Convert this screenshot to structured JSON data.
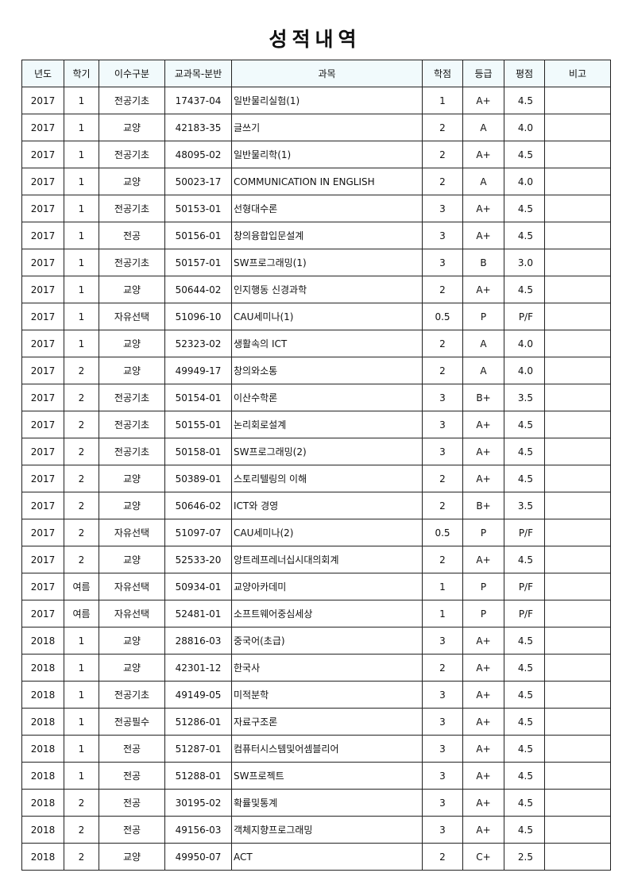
{
  "title": "성적내역",
  "columns": {
    "year": "년도",
    "term": "학기",
    "category": "이수구분",
    "code": "교과목-분반",
    "course": "과목",
    "credits": "학점",
    "grade": "등급",
    "score": "평점",
    "note": "비고"
  },
  "rows": [
    {
      "year": "2017",
      "term": "1",
      "category": "전공기초",
      "code": "17437-04",
      "course": "일반물리실험(1)",
      "credits": "1",
      "grade": "A+",
      "score": "4.5",
      "note": ""
    },
    {
      "year": "2017",
      "term": "1",
      "category": "교양",
      "code": "42183-35",
      "course": "글쓰기",
      "credits": "2",
      "grade": "A",
      "score": "4.0",
      "note": ""
    },
    {
      "year": "2017",
      "term": "1",
      "category": "전공기초",
      "code": "48095-02",
      "course": "일반물리학(1)",
      "credits": "2",
      "grade": "A+",
      "score": "4.5",
      "note": ""
    },
    {
      "year": "2017",
      "term": "1",
      "category": "교양",
      "code": "50023-17",
      "course": "COMMUNICATION IN ENGLISH",
      "credits": "2",
      "grade": "A",
      "score": "4.0",
      "note": ""
    },
    {
      "year": "2017",
      "term": "1",
      "category": "전공기초",
      "code": "50153-01",
      "course": "선형대수론",
      "credits": "3",
      "grade": "A+",
      "score": "4.5",
      "note": ""
    },
    {
      "year": "2017",
      "term": "1",
      "category": "전공",
      "code": "50156-01",
      "course": "창의융합입문설계",
      "credits": "3",
      "grade": "A+",
      "score": "4.5",
      "note": ""
    },
    {
      "year": "2017",
      "term": "1",
      "category": "전공기초",
      "code": "50157-01",
      "course": "SW프로그래밍(1)",
      "credits": "3",
      "grade": "B",
      "score": "3.0",
      "note": ""
    },
    {
      "year": "2017",
      "term": "1",
      "category": "교양",
      "code": "50644-02",
      "course": "인지행동 신경과학",
      "credits": "2",
      "grade": "A+",
      "score": "4.5",
      "note": ""
    },
    {
      "year": "2017",
      "term": "1",
      "category": "자유선택",
      "code": "51096-10",
      "course": "CAU세미나(1)",
      "credits": "0.5",
      "grade": "P",
      "score": "P/F",
      "note": ""
    },
    {
      "year": "2017",
      "term": "1",
      "category": "교양",
      "code": "52323-02",
      "course": "생활속의 ICT",
      "credits": "2",
      "grade": "A",
      "score": "4.0",
      "note": ""
    },
    {
      "year": "2017",
      "term": "2",
      "category": "교양",
      "code": "49949-17",
      "course": "창의와소통",
      "credits": "2",
      "grade": "A",
      "score": "4.0",
      "note": ""
    },
    {
      "year": "2017",
      "term": "2",
      "category": "전공기초",
      "code": "50154-01",
      "course": "이산수학론",
      "credits": "3",
      "grade": "B+",
      "score": "3.5",
      "note": ""
    },
    {
      "year": "2017",
      "term": "2",
      "category": "전공기초",
      "code": "50155-01",
      "course": "논리회로설계",
      "credits": "3",
      "grade": "A+",
      "score": "4.5",
      "note": ""
    },
    {
      "year": "2017",
      "term": "2",
      "category": "전공기초",
      "code": "50158-01",
      "course": "SW프로그래밍(2)",
      "credits": "3",
      "grade": "A+",
      "score": "4.5",
      "note": ""
    },
    {
      "year": "2017",
      "term": "2",
      "category": "교양",
      "code": "50389-01",
      "course": "스토리텔링의 이해",
      "credits": "2",
      "grade": "A+",
      "score": "4.5",
      "note": ""
    },
    {
      "year": "2017",
      "term": "2",
      "category": "교양",
      "code": "50646-02",
      "course": "ICT와 경영",
      "credits": "2",
      "grade": "B+",
      "score": "3.5",
      "note": ""
    },
    {
      "year": "2017",
      "term": "2",
      "category": "자유선택",
      "code": "51097-07",
      "course": "CAU세미나(2)",
      "credits": "0.5",
      "grade": "P",
      "score": "P/F",
      "note": ""
    },
    {
      "year": "2017",
      "term": "2",
      "category": "교양",
      "code": "52533-20",
      "course": "앙트레프레너십시대의회계",
      "credits": "2",
      "grade": "A+",
      "score": "4.5",
      "note": ""
    },
    {
      "year": "2017",
      "term": "여름",
      "category": "자유선택",
      "code": "50934-01",
      "course": "교양아카데미",
      "credits": "1",
      "grade": "P",
      "score": "P/F",
      "note": ""
    },
    {
      "year": "2017",
      "term": "여름",
      "category": "자유선택",
      "code": "52481-01",
      "course": "소프트웨어중심세상",
      "credits": "1",
      "grade": "P",
      "score": "P/F",
      "note": ""
    },
    {
      "year": "2018",
      "term": "1",
      "category": "교양",
      "code": "28816-03",
      "course": "중국어(초급)",
      "credits": "3",
      "grade": "A+",
      "score": "4.5",
      "note": ""
    },
    {
      "year": "2018",
      "term": "1",
      "category": "교양",
      "code": "42301-12",
      "course": "한국사",
      "credits": "2",
      "grade": "A+",
      "score": "4.5",
      "note": ""
    },
    {
      "year": "2018",
      "term": "1",
      "category": "전공기초",
      "code": "49149-05",
      "course": "미적분학",
      "credits": "3",
      "grade": "A+",
      "score": "4.5",
      "note": ""
    },
    {
      "year": "2018",
      "term": "1",
      "category": "전공필수",
      "code": "51286-01",
      "course": "자료구조론",
      "credits": "3",
      "grade": "A+",
      "score": "4.5",
      "note": ""
    },
    {
      "year": "2018",
      "term": "1",
      "category": "전공",
      "code": "51287-01",
      "course": "컴퓨터시스템및어셈블리어",
      "credits": "3",
      "grade": "A+",
      "score": "4.5",
      "note": ""
    },
    {
      "year": "2018",
      "term": "1",
      "category": "전공",
      "code": "51288-01",
      "course": "SW프로젝트",
      "credits": "3",
      "grade": "A+",
      "score": "4.5",
      "note": ""
    },
    {
      "year": "2018",
      "term": "2",
      "category": "전공",
      "code": "30195-02",
      "course": "확률및통계",
      "credits": "3",
      "grade": "A+",
      "score": "4.5",
      "note": ""
    },
    {
      "year": "2018",
      "term": "2",
      "category": "전공",
      "code": "49156-03",
      "course": "객체지향프로그래밍",
      "credits": "3",
      "grade": "A+",
      "score": "4.5",
      "note": ""
    },
    {
      "year": "2018",
      "term": "2",
      "category": "교양",
      "code": "49950-07",
      "course": "ACT",
      "credits": "2",
      "grade": "C+",
      "score": "2.5",
      "note": ""
    }
  ]
}
